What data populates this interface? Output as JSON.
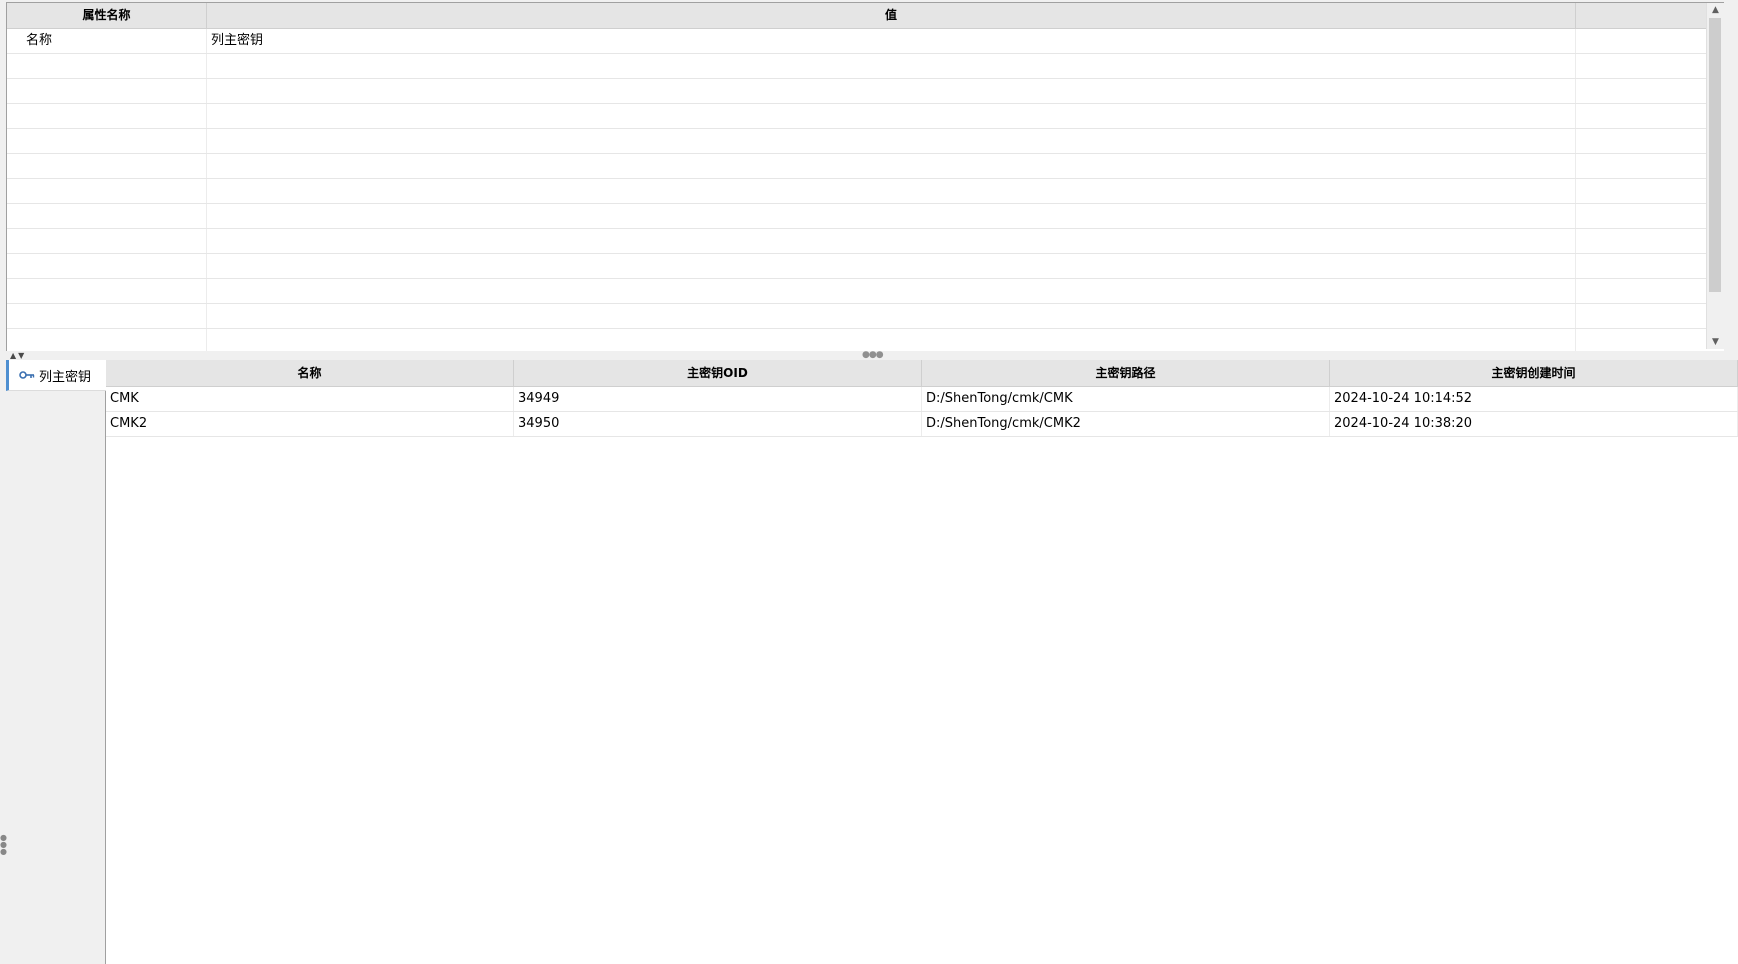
{
  "properties": {
    "headers": [
      "属性名称",
      "值",
      ""
    ],
    "rows": [
      {
        "name": "名称",
        "value": "列主密钥"
      }
    ],
    "empty_rows": 12
  },
  "side_nav": {
    "items": [
      {
        "label": "列主密钥",
        "icon": "key-icon",
        "selected": true
      }
    ]
  },
  "cmk_table": {
    "headers": [
      "名称",
      "主密钥OID",
      "主密钥路径",
      "主密钥创建时间"
    ],
    "rows": [
      [
        "CMK",
        "34949",
        "D:/ShenTong/cmk/CMK",
        "2024-10-24 10:14:52"
      ],
      [
        "CMK2",
        "34950",
        "D:/ShenTong/cmk/CMK2",
        "2024-10-24 10:38:20"
      ]
    ]
  },
  "colors": {
    "accent": "#4e8fd1",
    "header_bg": "#e5e5e5",
    "panel_bg": "#f0f0f0"
  }
}
